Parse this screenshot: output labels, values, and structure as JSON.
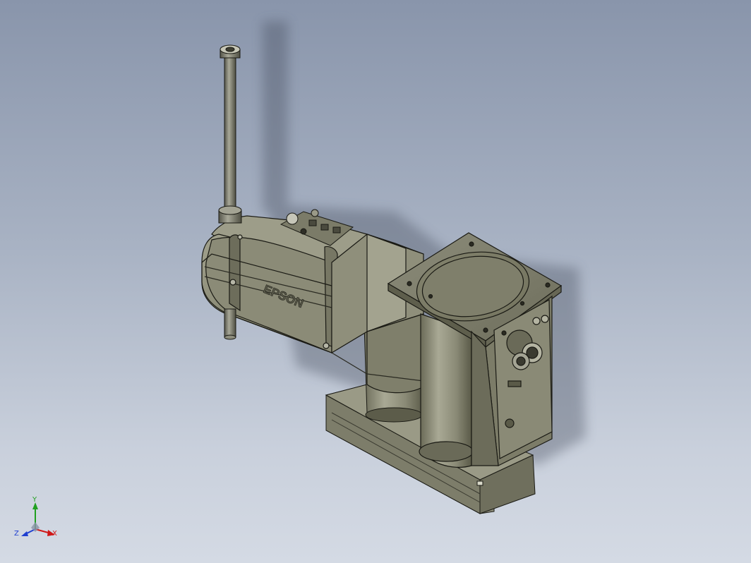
{
  "viewport": {
    "background_top": "#8995ab",
    "background_bottom": "#d4dae4"
  },
  "model": {
    "brand_label": "EPSON",
    "body_color": "#8a8a78",
    "edge_color": "#1a1a14"
  },
  "triad": {
    "x_label": "X",
    "y_label": "Y",
    "z_label": "Z",
    "x_color": "#d01818",
    "y_color": "#20a020",
    "z_color": "#2040d0"
  }
}
